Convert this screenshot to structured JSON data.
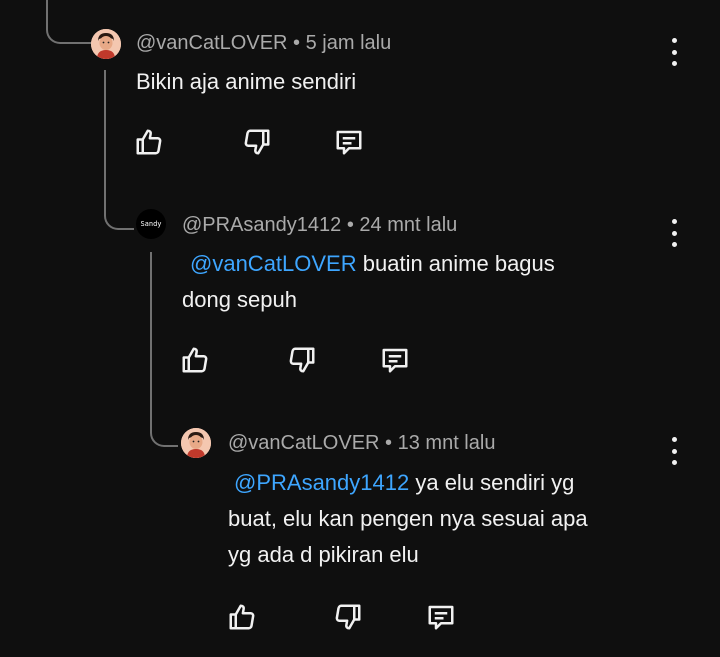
{
  "comments": [
    {
      "handle": "@vanCatLOVER",
      "time": "5 jam lalu",
      "mention": "",
      "text": "Bikin aja anime sendiri",
      "avatar_icon": "boy-avatar-icon"
    },
    {
      "handle": "@PRAsandy1412",
      "time": "24 mnt lalu",
      "mention": "@vanCatLOVER",
      "text_line1": "buatin anime bagus",
      "text_line2": "dong sepuh",
      "avatar_label": "Sandy",
      "avatar_icon": "sandy-logo-icon"
    },
    {
      "handle": "@vanCatLOVER",
      "time": "13 mnt lalu",
      "mention": "@PRAsandy1412",
      "text_line1": "ya elu sendiri yg",
      "text_line2": "buat, elu kan pengen nya sesuai apa",
      "text_line3": "yg ada d pikiran elu",
      "avatar_icon": "boy-avatar-icon"
    }
  ],
  "separator": " • ",
  "colors": {
    "background": "#0f0f0f",
    "mention": "#3ea6ff",
    "meta": "#aaaaaa",
    "thread_line": "#717171"
  }
}
